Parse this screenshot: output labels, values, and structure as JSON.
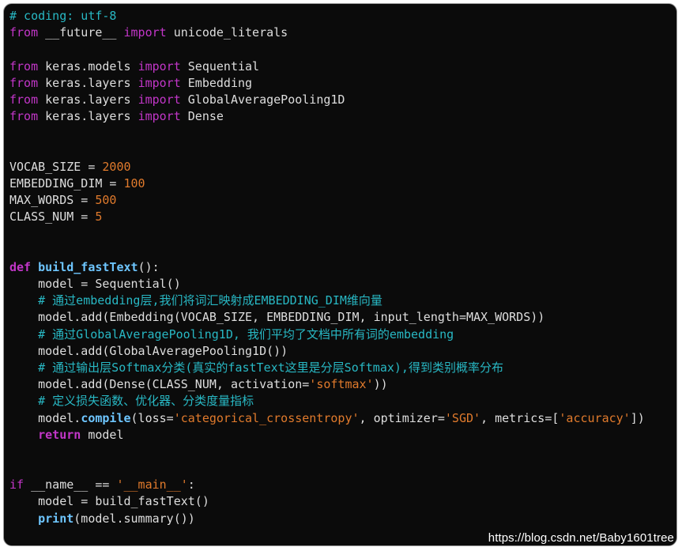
{
  "editor": {
    "background": "#0b0b0b",
    "colors": {
      "comment": "#28b8c4",
      "keyword": "#c236c8",
      "function_name": "#6ec6ff",
      "number": "#e07a2c",
      "string": "#e07a2c",
      "text": "#dedede"
    },
    "lines": [
      [
        {
          "t": "# coding: utf-8",
          "k": "cm"
        }
      ],
      [
        {
          "t": "from",
          "k": "kw"
        },
        {
          "t": " __future__ ",
          "k": "tx"
        },
        {
          "t": "import",
          "k": "kw"
        },
        {
          "t": " unicode_literals",
          "k": "tx"
        }
      ],
      [],
      [
        {
          "t": "from",
          "k": "kw"
        },
        {
          "t": " keras.models ",
          "k": "tx"
        },
        {
          "t": "import",
          "k": "kw"
        },
        {
          "t": " Sequential",
          "k": "tx"
        }
      ],
      [
        {
          "t": "from",
          "k": "kw"
        },
        {
          "t": " keras.layers ",
          "k": "tx"
        },
        {
          "t": "import",
          "k": "kw"
        },
        {
          "t": " Embedding",
          "k": "tx"
        }
      ],
      [
        {
          "t": "from",
          "k": "kw"
        },
        {
          "t": " keras.layers ",
          "k": "tx"
        },
        {
          "t": "import",
          "k": "kw"
        },
        {
          "t": " GlobalAveragePooling1D",
          "k": "tx"
        }
      ],
      [
        {
          "t": "from",
          "k": "kw"
        },
        {
          "t": " keras.layers ",
          "k": "tx"
        },
        {
          "t": "import",
          "k": "kw"
        },
        {
          "t": " Dense",
          "k": "tx"
        }
      ],
      [],
      [],
      [
        {
          "t": "VOCAB_SIZE = ",
          "k": "tx"
        },
        {
          "t": "2000",
          "k": "nm"
        }
      ],
      [
        {
          "t": "EMBEDDING_DIM = ",
          "k": "tx"
        },
        {
          "t": "100",
          "k": "nm"
        }
      ],
      [
        {
          "t": "MAX_WORDS = ",
          "k": "tx"
        },
        {
          "t": "500",
          "k": "nm"
        }
      ],
      [
        {
          "t": "CLASS_NUM = ",
          "k": "tx"
        },
        {
          "t": "5",
          "k": "nm"
        }
      ],
      [],
      [],
      [
        {
          "t": "def",
          "k": "kb"
        },
        {
          "t": " ",
          "k": "tx"
        },
        {
          "t": "build_fastText",
          "k": "fn"
        },
        {
          "t": "():",
          "k": "tx"
        }
      ],
      [
        {
          "t": "    model = Sequential()",
          "k": "tx"
        }
      ],
      [
        {
          "t": "    # 通过embedding层,我们将词汇映射成EMBEDDING_DIM维向量",
          "k": "cm"
        }
      ],
      [
        {
          "t": "    model.add(Embedding(VOCAB_SIZE, EMBEDDING_DIM, input_length=MAX_WORDS))",
          "k": "tx"
        }
      ],
      [
        {
          "t": "    # 通过GlobalAveragePooling1D, 我们平均了文档中所有词的embedding",
          "k": "cm"
        }
      ],
      [
        {
          "t": "    model.add(GlobalAveragePooling1D())",
          "k": "tx"
        }
      ],
      [
        {
          "t": "    # 通过输出层Softmax分类(真实的fastText这里是分层Softmax),得到类别概率分布",
          "k": "cm"
        }
      ],
      [
        {
          "t": "    model.add(Dense(CLASS_NUM, activation=",
          "k": "tx"
        },
        {
          "t": "'softmax'",
          "k": "st"
        },
        {
          "t": "))",
          "k": "tx"
        }
      ],
      [
        {
          "t": "    # 定义损失函数、优化器、分类度量指标",
          "k": "cm"
        }
      ],
      [
        {
          "t": "    model.",
          "k": "tx"
        },
        {
          "t": "compile",
          "k": "fn"
        },
        {
          "t": "(loss=",
          "k": "tx"
        },
        {
          "t": "'categorical_crossentropy'",
          "k": "st"
        },
        {
          "t": ", optimizer=",
          "k": "tx"
        },
        {
          "t": "'SGD'",
          "k": "st"
        },
        {
          "t": ", metrics=[",
          "k": "tx"
        },
        {
          "t": "'accuracy'",
          "k": "st"
        },
        {
          "t": "])",
          "k": "tx"
        }
      ],
      [
        {
          "t": "    ",
          "k": "tx"
        },
        {
          "t": "return",
          "k": "kb"
        },
        {
          "t": " model",
          "k": "tx"
        }
      ],
      [],
      [],
      [
        {
          "t": "if",
          "k": "kw"
        },
        {
          "t": " __name__ == ",
          "k": "tx"
        },
        {
          "t": "'__main__'",
          "k": "st"
        },
        {
          "t": ":",
          "k": "tx"
        }
      ],
      [
        {
          "t": "    model = build_fastText()",
          "k": "tx"
        }
      ],
      [
        {
          "t": "    ",
          "k": "tx"
        },
        {
          "t": "print",
          "k": "fn"
        },
        {
          "t": "(model.summary())",
          "k": "tx"
        }
      ]
    ]
  },
  "watermark": "https://blog.csdn.net/Baby1601tree"
}
